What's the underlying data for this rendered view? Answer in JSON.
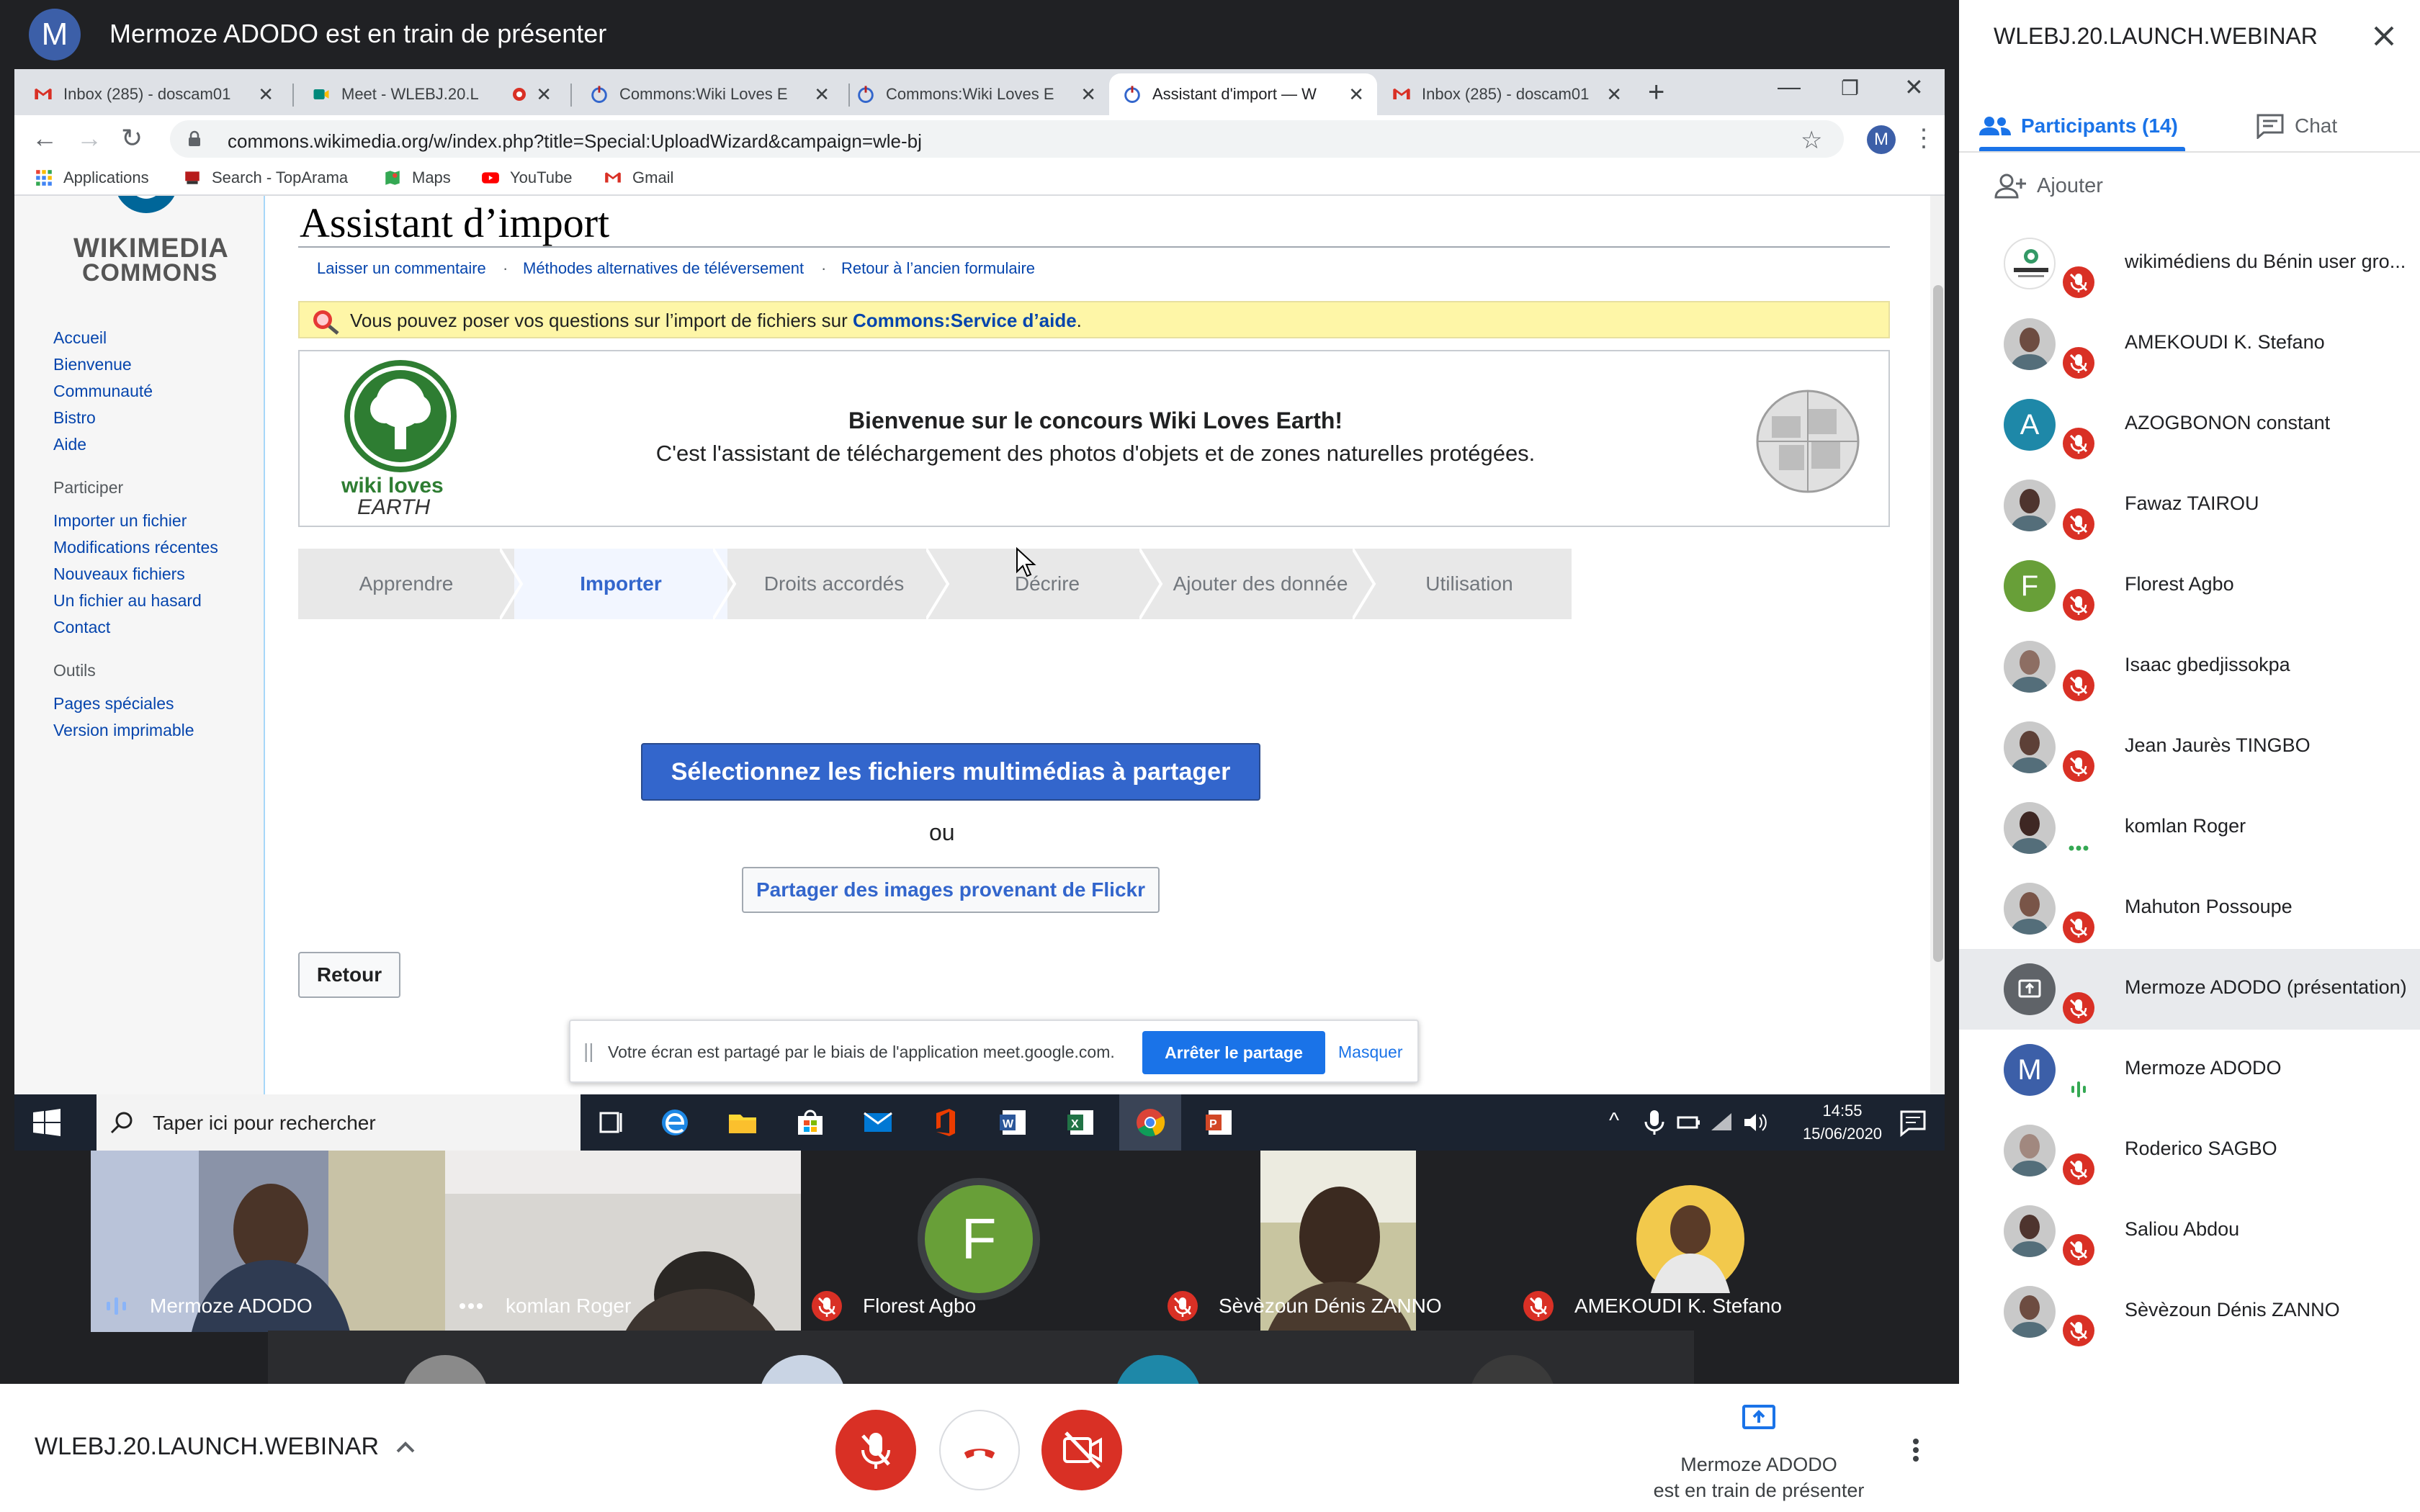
{
  "meet": {
    "presenter_initial": "M",
    "presenting_title": "Mermoze ADODO est en train de présenter",
    "meeting_name": "WLEBJ.20.LAUNCH.WEBINAR",
    "presenter_status_line1": "Mermoze ADODO",
    "presenter_status_line2": "est en train de présenter"
  },
  "browser": {
    "tabs": [
      {
        "label": "Inbox (285) - doscam01",
        "icon": "gmail-icon"
      },
      {
        "label": "Meet - WLEBJ.20.L",
        "icon": "meet-icon"
      },
      {
        "label": "Commons:Wiki Loves E",
        "icon": "commons-icon"
      },
      {
        "label": "Commons:Wiki Loves E",
        "icon": "commons-icon"
      },
      {
        "label": "Assistant d'import — W",
        "icon": "commons-icon",
        "active": true
      },
      {
        "label": "Inbox (285) - doscam01",
        "icon": "gmail-icon"
      }
    ],
    "url": "commons.wikimedia.org/w/index.php?title=Special:UploadWizard&campaign=wle-bj",
    "profile_initial": "M",
    "bookmarks": [
      "Applications",
      "Search - TopArama",
      "Maps",
      "YouTube",
      "Gmail"
    ]
  },
  "wiki": {
    "logo_line1": "WIKIMEDIA",
    "logo_line2": "COMMONS",
    "nav": [
      "Accueil",
      "Bienvenue",
      "Communauté",
      "Bistro",
      "Aide"
    ],
    "participer_heading": "Participer",
    "participer": [
      "Importer un fichier",
      "Modifications récentes",
      "Nouveaux fichiers",
      "Un fichier au hasard",
      "Contact"
    ],
    "outils_heading": "Outils",
    "outils": [
      "Pages spéciales",
      "Version imprimable"
    ],
    "title": "Assistant d’import",
    "top_links": [
      "Laisser un commentaire",
      "Méthodes alternatives de téléversement",
      "Retour à l’ancien formulaire"
    ],
    "notice_text": "Vous pouvez poser vos questions sur l’import de fichiers sur ",
    "notice_link": "Commons:Service d’aide",
    "notice_end": ".",
    "wle_logo_line1": "wiki loves",
    "wle_logo_line2": "EARTH",
    "welcome_title": "Bienvenue sur le concours Wiki Loves Earth!",
    "welcome_sub": "C'est l'assistant de téléchargement des photos d'objets et de zones naturelles protégées.",
    "steps": [
      "Apprendre",
      "Importer",
      "Droits accordés",
      "Décrire",
      "Ajouter des donnée",
      "Utilisation"
    ],
    "current_step": "Importer",
    "select_button": "Sélectionnez les fichiers multimédias à partager",
    "or_text": "ou",
    "flickr_button": "Partager des images provenant de Flickr",
    "back_button": "Retour"
  },
  "share_banner": {
    "grip": "||",
    "text": "Votre écran est partagé par le biais de l'application meet.google.com.",
    "stop": "Arrêter le partage",
    "hide": "Masquer"
  },
  "taskbar": {
    "search_placeholder": "Taper ici pour rechercher",
    "time": "14:55",
    "date": "15/06/2020"
  },
  "video_tiles": [
    {
      "name": "Mermoze ADODO",
      "status": "speaking"
    },
    {
      "name": "komlan Roger",
      "status": "connecting"
    },
    {
      "name": "Florest Agbo",
      "status": "muted",
      "initial": "F"
    },
    {
      "name": "Sèvèzoun Dénis ZANNO",
      "status": "muted"
    },
    {
      "name": "AMEKOUDI K. Stefano",
      "status": "muted"
    }
  ],
  "panel": {
    "title": "WLEBJ.20.LAUNCH.WEBINAR",
    "participants_tab": "Participants (14)",
    "chat_tab": "Chat",
    "add_label": "Ajouter",
    "participants": [
      {
        "name": "wikimédiens du Bénin user gro...",
        "avatar": "logo",
        "mic": "muted"
      },
      {
        "name": "AMEKOUDI K. Stefano",
        "avatar": "photo",
        "mic": "muted"
      },
      {
        "name": "AZOGBONON constant",
        "avatar": "initial",
        "initial": "A",
        "color": "#1e88a8",
        "mic": "muted"
      },
      {
        "name": "Fawaz TAIROU",
        "avatar": "photo",
        "mic": "muted"
      },
      {
        "name": "Florest Agbo",
        "avatar": "initial",
        "initial": "F",
        "color": "#689f38",
        "mic": "muted"
      },
      {
        "name": "Isaac gbedjissokpa",
        "avatar": "photo",
        "mic": "muted"
      },
      {
        "name": "Jean Jaurès TINGBO",
        "avatar": "photo",
        "mic": "muted"
      },
      {
        "name": "komlan Roger",
        "avatar": "photo",
        "mic": "connecting"
      },
      {
        "name": "Mahuton Possoupe",
        "avatar": "photo",
        "mic": "muted"
      },
      {
        "name": "Mermoze ADODO (présentation)",
        "avatar": "present",
        "mic": "muted",
        "highlight": true
      },
      {
        "name": "Mermoze ADODO",
        "avatar": "initial",
        "initial": "M",
        "color": "#3c5fa8",
        "mic": "speaking"
      },
      {
        "name": "Roderico SAGBO",
        "avatar": "photo",
        "mic": "muted"
      },
      {
        "name": "Saliou Abdou",
        "avatar": "photo",
        "mic": "muted"
      },
      {
        "name": "Sèvèzoun Dénis ZANNO",
        "avatar": "photo",
        "mic": "muted"
      }
    ]
  },
  "colors": {
    "meet_dark": "#202124",
    "muted_red": "#d93025",
    "link_blue": "#0645ad",
    "accent_blue": "#1a73e8",
    "wiki_button": "#3366cc",
    "notice_yellow": "#fef6a7"
  }
}
